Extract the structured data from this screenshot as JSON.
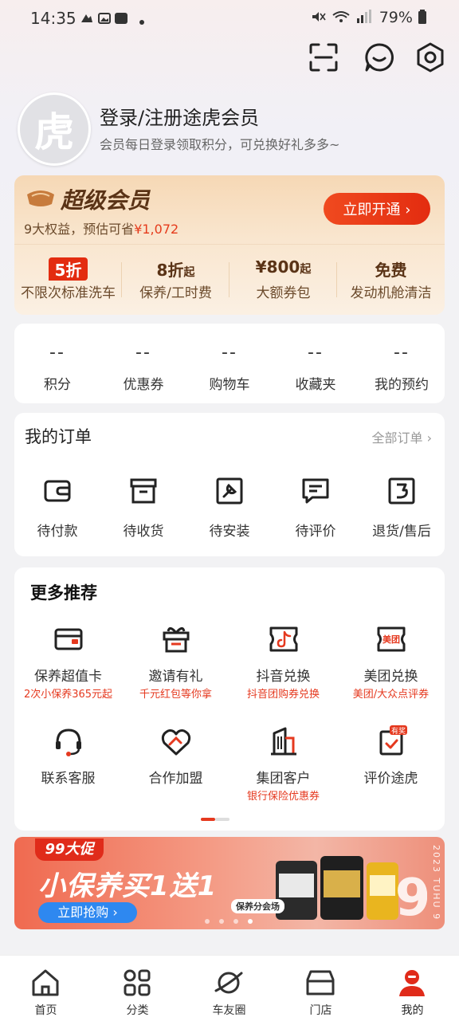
{
  "status_bar": {
    "time": "14:35",
    "battery": "79%"
  },
  "header": {
    "icons": [
      "scan-icon",
      "message-icon",
      "settings-icon"
    ]
  },
  "profile": {
    "avatar_char": "虎",
    "title": "登录/注册途虎会员",
    "subtitle": "会员每日登录领取积分，可兑换好礼多多~"
  },
  "membership": {
    "title": "超级会员",
    "subtitle_prefix": "9大权益，预估可省",
    "subtitle_amount": "¥1,072",
    "button_label": "立即开通 ›",
    "benefits": [
      {
        "big": "5折",
        "big_suffix": "",
        "small": "不限次标准洗车",
        "tag": true
      },
      {
        "big": "8折",
        "big_suffix": "起",
        "small": "保养/工时费",
        "tag": false
      },
      {
        "big": "¥800",
        "big_suffix": "起",
        "small": "大额券包",
        "tag": false
      },
      {
        "big": "免费",
        "big_suffix": "",
        "small": "发动机舱清洁",
        "tag": false
      }
    ]
  },
  "stats": [
    {
      "value": "--",
      "label": "积分"
    },
    {
      "value": "--",
      "label": "优惠券"
    },
    {
      "value": "--",
      "label": "购物车"
    },
    {
      "value": "--",
      "label": "收藏夹"
    },
    {
      "value": "--",
      "label": "我的预约"
    }
  ],
  "orders": {
    "title": "我的订单",
    "all_label": "全部订单 ›",
    "items": [
      {
        "label": "待付款",
        "icon": "wallet-icon"
      },
      {
        "label": "待收货",
        "icon": "box-icon"
      },
      {
        "label": "待安装",
        "icon": "wrench-icon"
      },
      {
        "label": "待评价",
        "icon": "comment-icon"
      },
      {
        "label": "退货/售后",
        "icon": "return-icon"
      }
    ]
  },
  "recommend": {
    "title": "更多推荐",
    "items": [
      {
        "label": "保养超值卡",
        "sub": "2次小保养365元起",
        "icon": "card-icon"
      },
      {
        "label": "邀请有礼",
        "sub": "千元红包等你拿",
        "icon": "gift-icon"
      },
      {
        "label": "抖音兑换",
        "sub": "抖音团购券兑换",
        "icon": "douyin-icon"
      },
      {
        "label": "美团兑换",
        "sub": "美团/大众点评券",
        "icon": "meituan-icon",
        "badge_text": "美团"
      },
      {
        "label": "联系客服",
        "sub": "",
        "icon": "headset-icon"
      },
      {
        "label": "合作加盟",
        "sub": "",
        "icon": "handshake-icon"
      },
      {
        "label": "集团客户",
        "sub": "银行保险优惠券",
        "icon": "building-icon"
      },
      {
        "label": "评价途虎",
        "sub": "",
        "icon": "review-icon",
        "badge": "有奖"
      }
    ]
  },
  "banner": {
    "tag": "99大促",
    "headline": "小保养买1送1",
    "cta": "立即抢购 ›",
    "store_tag": "保养分会场",
    "year_text": "2023 TUHU 9"
  },
  "bottom_nav": [
    {
      "label": "首页",
      "icon": "home-icon"
    },
    {
      "label": "分类",
      "icon": "grid-icon"
    },
    {
      "label": "车友圈",
      "icon": "planet-icon"
    },
    {
      "label": "门店",
      "icon": "store-icon"
    },
    {
      "label": "我的",
      "icon": "user-icon",
      "active": true
    }
  ],
  "colors": {
    "accent": "#e5391f",
    "brand_gold": "#5a3316",
    "nav_active": "#e02b1a"
  }
}
